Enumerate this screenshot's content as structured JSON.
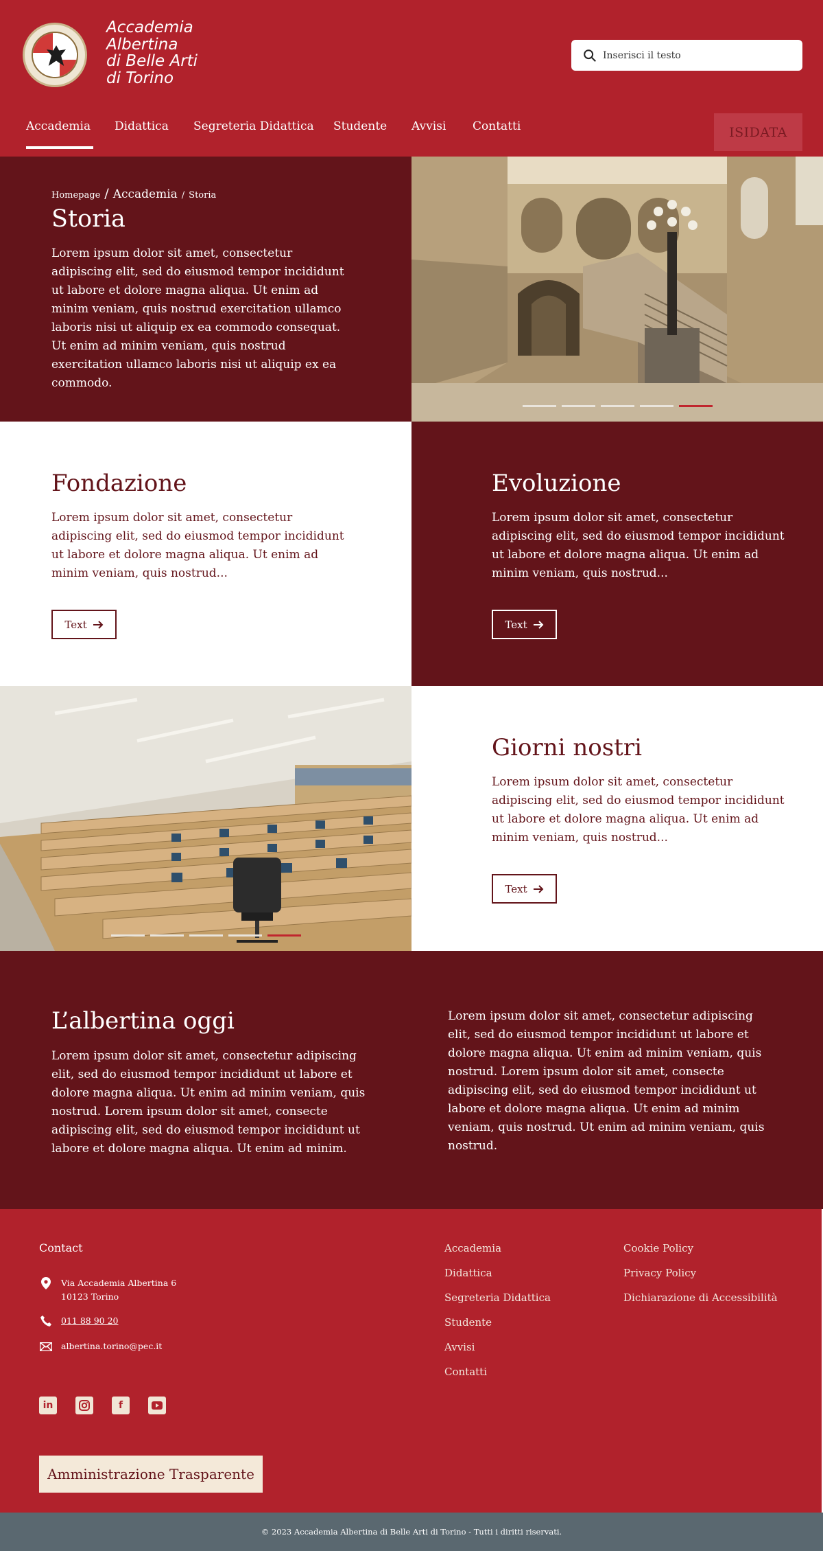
{
  "header": {
    "logo_lines": [
      "Accademia",
      "Albertina",
      "di Belle Arti",
      "di Torino"
    ],
    "search_placeholder": "Inserisci il testo",
    "nav": [
      {
        "label": "Accademia",
        "active": true
      },
      {
        "label": "Didattica"
      },
      {
        "label": "Segreteria Didattica"
      },
      {
        "label": "Studente"
      },
      {
        "label": "Avvisi"
      },
      {
        "label": "Contatti"
      }
    ],
    "isidata_label": "ISIDATA"
  },
  "hero": {
    "breadcrumb": [
      "Homepage",
      "Accademia",
      "Storia"
    ],
    "title": "Storia",
    "text": "Lorem ipsum dolor sit amet, consectetur adipiscing elit, sed do eiusmod tempor incididunt ut labore et dolore magna aliqua. Ut enim ad minim veniam, quis nostrud exercitation ullamco laboris nisi ut aliquip ex ea commodo consequat. Ut enim ad minim veniam, quis nostrud exercitation ullamco laboris nisi ut aliquip ex ea commodo.",
    "carousel_active": 5,
    "carousel_count": 5
  },
  "sections": {
    "fondazione": {
      "title": "Fondazione",
      "text": "Lorem ipsum dolor sit amet, consectetur adipiscing elit, sed do eiusmod tempor incididunt ut labore et dolore magna aliqua. Ut enim ad minim veniam, quis nostrud...",
      "button": "Text"
    },
    "evoluzione": {
      "title": "Evoluzione",
      "text": "Lorem ipsum dolor sit amet, consectetur adipiscing elit, sed do eiusmod tempor incididunt ut labore et dolore magna aliqua. Ut enim ad minim veniam, quis nostrud...",
      "button": "Text"
    },
    "giorni": {
      "title": "Giorni nostri",
      "text": "Lorem ipsum dolor sit amet, consectetur adipiscing elit, sed do eiusmod tempor incididunt ut labore et dolore magna aliqua. Ut enim ad minim veniam, quis nostrud...",
      "button": "Text"
    }
  },
  "oggi": {
    "title": "L’albertina oggi",
    "text_left": "Lorem ipsum dolor sit amet, consectetur adipiscing elit, sed do eiusmod tempor incididunt ut labore et dolore magna aliqua. Ut enim ad minim veniam, quis nostrud. Lorem ipsum dolor sit amet, consecte adipiscing elit, sed do eiusmod tempor incididunt ut labore et dolore magna aliqua. Ut enim ad minim.",
    "text_right": "Lorem ipsum dolor sit amet, consectetur adipiscing elit, sed do eiusmod tempor incididunt ut labore et dolore magna aliqua. Ut enim ad minim veniam, quis nostrud. Lorem ipsum dolor sit amet, consecte adipiscing elit, sed do eiusmod tempor incididunt ut labore et dolore magna aliqua. Ut enim ad minim veniam, quis nostrud. Ut enim ad minim veniam, quis nostrud."
  },
  "footer": {
    "contact_title": "Contact",
    "address_line1": "Via Accademia Albertina 6",
    "address_line2": "10123 Torino",
    "phone": "011 88 90 20",
    "email": "albertina.torino@pec.it",
    "links_col1": [
      "Accademia",
      "Didattica",
      "Segreteria Didattica",
      "Studente",
      "Avvisi",
      "Contatti"
    ],
    "links_col2": [
      "Cookie Policy",
      "Privacy Policy",
      "Dichiarazione di Accessibilità"
    ],
    "socials": [
      "linkedin-icon",
      "instagram-icon",
      "facebook-icon",
      "youtube-icon"
    ],
    "amministrazione": "Amministrazione Trasparente",
    "copyright": "© 2023 Accademia Albertina di Belle Arti di Torino - Tutti i diritti riservati."
  },
  "colors": {
    "primary": "#b1222c",
    "dark": "#63141a",
    "cream": "#f4e9d9",
    "bottom_bar": "#5a6870"
  }
}
